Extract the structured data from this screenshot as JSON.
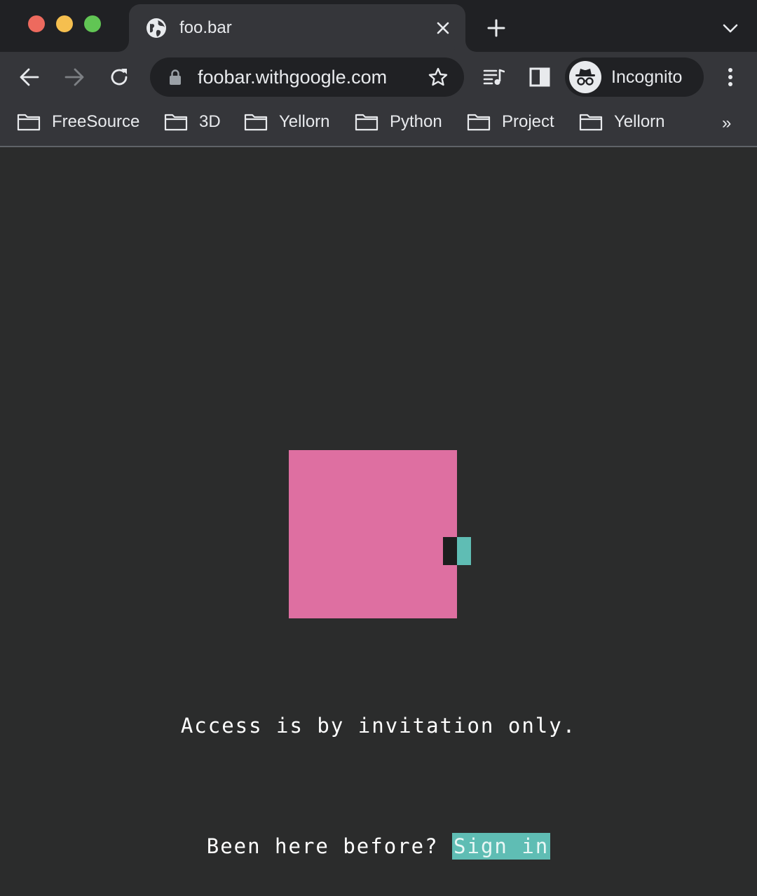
{
  "browser": {
    "tab": {
      "title": "foo.bar",
      "favicon": "globe-icon"
    },
    "address_bar": {
      "url": "foobar.withgoogle.com"
    },
    "profile": {
      "label": "Incognito"
    },
    "bookmarks": [
      {
        "label": "FreeSource",
        "icon": "folder-icon"
      },
      {
        "label": "3D",
        "icon": "folder-icon"
      },
      {
        "label": "Yellorn",
        "icon": "folder-icon"
      },
      {
        "label": "Python",
        "icon": "folder-icon"
      },
      {
        "label": "Project",
        "icon": "folder-icon"
      },
      {
        "label": "Yellorn",
        "icon": "folder-icon"
      }
    ],
    "bookmarks_overflow": "»"
  },
  "page": {
    "message": "Access is by invitation only.",
    "prompt": "Been here before?",
    "signin_label": "Sign in",
    "colors": {
      "background": "#2b2c2c",
      "square": "#de6fa1",
      "accent": "#5fbdb4"
    }
  }
}
